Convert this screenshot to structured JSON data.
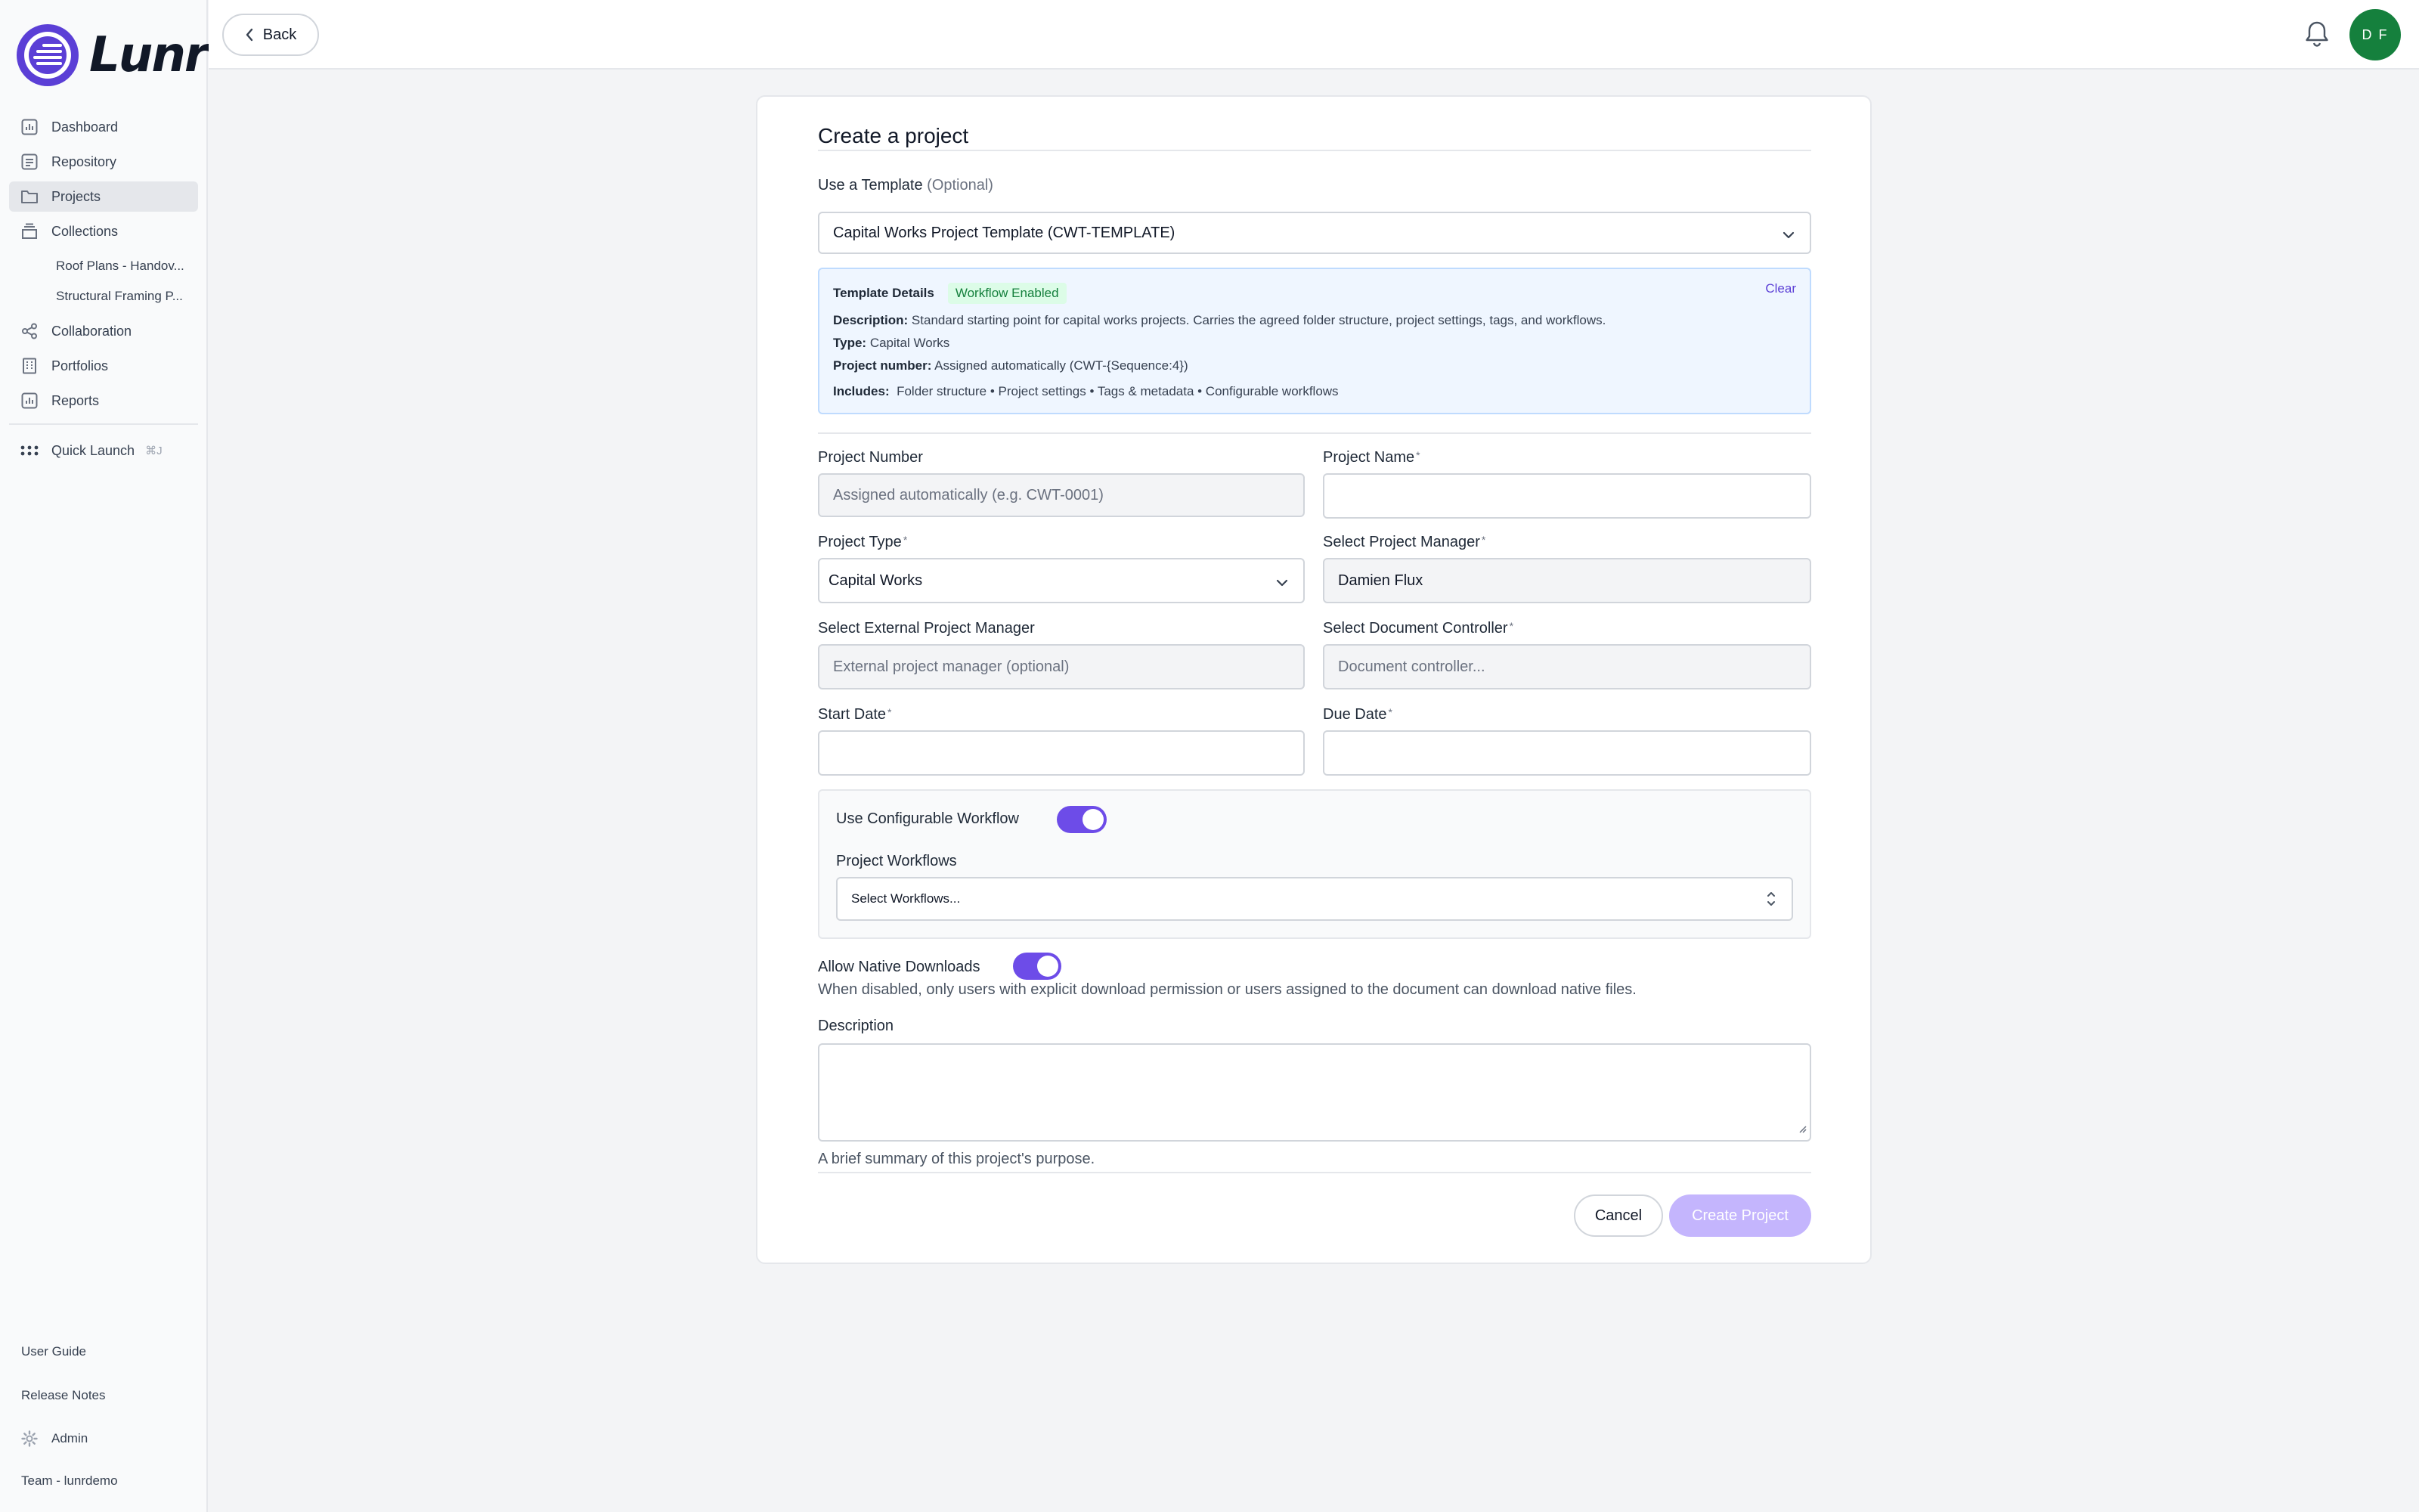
{
  "app": {
    "name": "Lunr",
    "brand_color": "#5b3fd6"
  },
  "sidebar": {
    "items": [
      {
        "label": "Dashboard",
        "icon": "chart-icon"
      },
      {
        "label": "Repository",
        "icon": "repository-icon"
      },
      {
        "label": "Projects",
        "icon": "folder-icon",
        "active": true
      },
      {
        "label": "Collections",
        "icon": "collections-icon"
      }
    ],
    "collections": [
      "Roof Plans - Handov...",
      "Structural Framing P..."
    ],
    "items2": [
      {
        "label": "Collaboration",
        "icon": "share-icon"
      },
      {
        "label": "Portfolios",
        "icon": "building-icon"
      },
      {
        "label": "Reports",
        "icon": "report-icon"
      }
    ],
    "quick_launch": {
      "label": "Quick Launch",
      "shortcut": "⌘J"
    },
    "bottom": {
      "user_guide": "User Guide",
      "release_notes": "Release Notes",
      "admin": "Admin",
      "team": "Team - lunrdemo"
    }
  },
  "topbar": {
    "back_label": "Back",
    "avatar_initials": "D F"
  },
  "form": {
    "title": "Create a project",
    "template": {
      "label": "Use a Template",
      "optional": "(Optional)",
      "selected": "Capital Works Project Template (CWT-TEMPLATE)",
      "details_title": "Template Details",
      "badge": "Workflow Enabled",
      "clear": "Clear",
      "description_key": "Description:",
      "description": "Standard starting point for capital works projects. Carries the agreed folder structure, project settings, tags, and workflows.",
      "type_key": "Type:",
      "type": "Capital Works",
      "number_key": "Project number:",
      "number": "Assigned automatically (CWT-{Sequence:4})",
      "includes_key": "Includes:",
      "includes": "Folder structure • Project settings • Tags & metadata • Configurable workflows"
    },
    "project_number": {
      "label": "Project Number",
      "placeholder": "Assigned automatically (e.g. CWT-0001)"
    },
    "project_name": {
      "label": "Project Name",
      "required": "*",
      "value": ""
    },
    "project_type": {
      "label": "Project Type",
      "required": "*",
      "value": "Capital Works"
    },
    "project_manager": {
      "label": "Select Project Manager",
      "required": "*",
      "value": "Damien Flux"
    },
    "external_manager": {
      "label": "Select External Project Manager",
      "placeholder": "External project manager (optional)"
    },
    "document_controller": {
      "label": "Select Document Controller",
      "required": "*",
      "placeholder": "Document controller..."
    },
    "start_date": {
      "label": "Start Date",
      "required": "*",
      "value": ""
    },
    "due_date": {
      "label": "Due Date",
      "required": "*",
      "value": ""
    },
    "workflow": {
      "toggle_label": "Use Configurable Workflow",
      "enabled": true,
      "workflows_label": "Project Workflows",
      "workflows_placeholder": "Select Workflows..."
    },
    "native_downloads": {
      "label": "Allow Native Downloads",
      "enabled": true,
      "help": "When disabled, only users with explicit download permission or users assigned to the document can download native files."
    },
    "description": {
      "label": "Description",
      "help": "A brief summary of this project's purpose."
    },
    "cancel_label": "Cancel",
    "create_label": "Create Project"
  }
}
